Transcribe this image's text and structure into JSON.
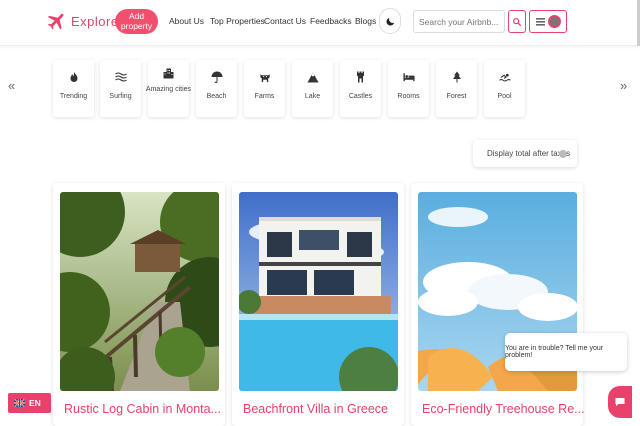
{
  "header": {
    "brand": "Explore",
    "add_property": "Add property",
    "nav": [
      "About Us",
      "Top Properties",
      "Contact Us",
      "Feedbacks",
      "Blogs"
    ],
    "search_placeholder": "Search your Airbnb..."
  },
  "categories": [
    {
      "label": "Trending",
      "icon": "fire-icon"
    },
    {
      "label": "Surfing",
      "icon": "waves-icon"
    },
    {
      "label": "Amazing cities",
      "icon": "city-icon"
    },
    {
      "label": "Beach",
      "icon": "umbrella-icon"
    },
    {
      "label": "Farms",
      "icon": "cow-icon"
    },
    {
      "label": "Lake",
      "icon": "mountain-icon"
    },
    {
      "label": "Castles",
      "icon": "tower-icon"
    },
    {
      "label": "Rooms",
      "icon": "bed-icon"
    },
    {
      "label": "Forest",
      "icon": "tree-icon"
    },
    {
      "label": "Pool",
      "icon": "swimmer-icon"
    }
  ],
  "carousel": {
    "prev": "«",
    "next": "»"
  },
  "tax_toggle": {
    "label": "Display total after taxes",
    "enabled": false
  },
  "listings": [
    {
      "title": "Rustic Log Cabin in Monta..."
    },
    {
      "title": "Beachfront Villa in Greece"
    },
    {
      "title": "Eco-Friendly Treehouse Re..."
    }
  ],
  "chat": {
    "message": "You are in trouble? Tell me your problem!"
  },
  "language": {
    "code": "EN"
  },
  "colors": {
    "accent": "#e8416b",
    "button": "#f0506e"
  }
}
